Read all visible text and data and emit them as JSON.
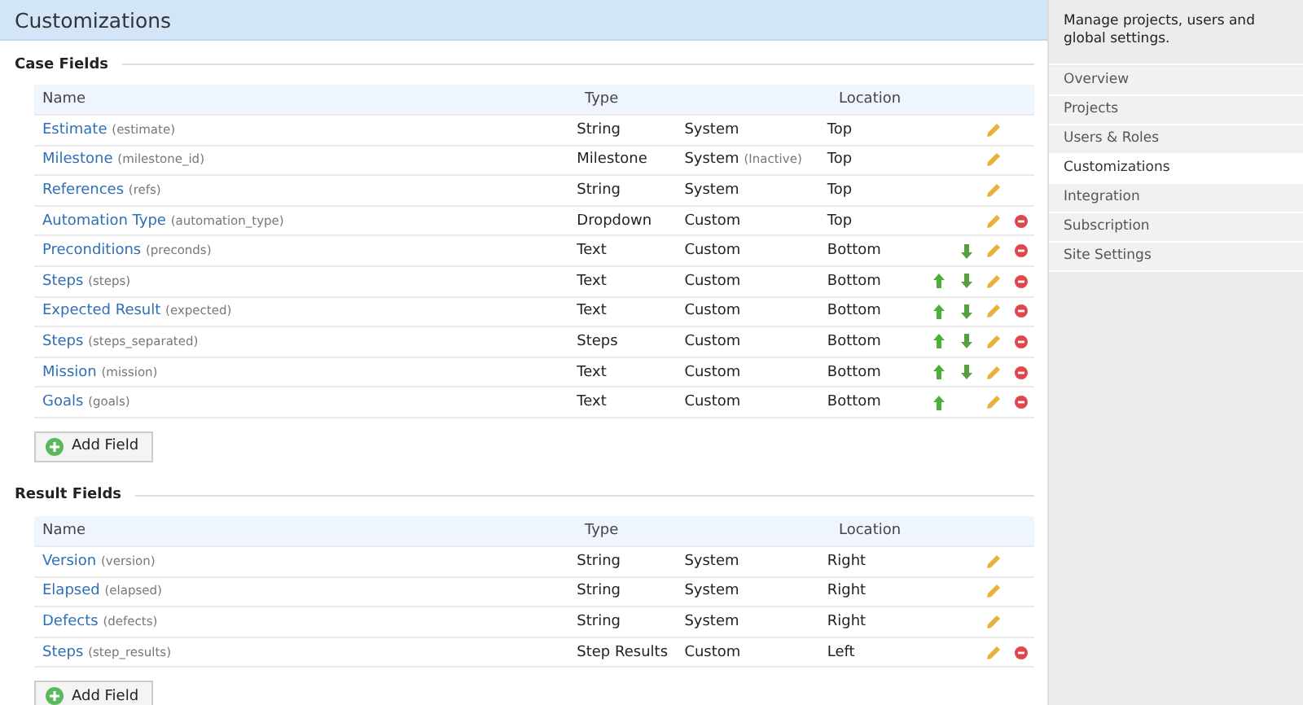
{
  "page_title": "Customizations",
  "sections": [
    {
      "title": "Case Fields",
      "columns": [
        "Name",
        "Type",
        "Location"
      ],
      "rows": [
        {
          "name": "Estimate",
          "key": "(estimate)",
          "type": "String",
          "source": "System",
          "location": "Top",
          "move_up": false,
          "move_down": false,
          "deletable": false
        },
        {
          "name": "Milestone",
          "key": "(milestone_id)",
          "type": "Milestone",
          "source": "System",
          "note": "(Inactive)",
          "location": "Top",
          "move_up": false,
          "move_down": false,
          "deletable": false
        },
        {
          "name": "References",
          "key": "(refs)",
          "type": "String",
          "source": "System",
          "location": "Top",
          "move_up": false,
          "move_down": false,
          "deletable": false
        },
        {
          "name": "Automation Type",
          "key": "(automation_type)",
          "type": "Dropdown",
          "source": "Custom",
          "location": "Top",
          "move_up": false,
          "move_down": false,
          "deletable": true
        },
        {
          "name": "Preconditions",
          "key": "(preconds)",
          "type": "Text",
          "source": "Custom",
          "location": "Bottom",
          "move_up": false,
          "move_down": true,
          "deletable": true
        },
        {
          "name": "Steps",
          "key": "(steps)",
          "type": "Text",
          "source": "Custom",
          "location": "Bottom",
          "move_up": true,
          "move_down": true,
          "deletable": true
        },
        {
          "name": "Expected Result",
          "key": "(expected)",
          "type": "Text",
          "source": "Custom",
          "location": "Bottom",
          "move_up": true,
          "move_down": true,
          "deletable": true
        },
        {
          "name": "Steps",
          "key": "(steps_separated)",
          "type": "Steps",
          "source": "Custom",
          "location": "Bottom",
          "move_up": true,
          "move_down": true,
          "deletable": true
        },
        {
          "name": "Mission",
          "key": "(mission)",
          "type": "Text",
          "source": "Custom",
          "location": "Bottom",
          "move_up": true,
          "move_down": true,
          "deletable": true
        },
        {
          "name": "Goals",
          "key": "(goals)",
          "type": "Text",
          "source": "Custom",
          "location": "Bottom",
          "move_up": true,
          "move_down": false,
          "deletable": true
        }
      ],
      "button": "Add Field"
    },
    {
      "title": "Result Fields",
      "columns": [
        "Name",
        "Type",
        "Location"
      ],
      "rows": [
        {
          "name": "Version",
          "key": "(version)",
          "type": "String",
          "source": "System",
          "location": "Right",
          "move_up": false,
          "move_down": false,
          "deletable": false
        },
        {
          "name": "Elapsed",
          "key": "(elapsed)",
          "type": "String",
          "source": "System",
          "location": "Right",
          "move_up": false,
          "move_down": false,
          "deletable": false
        },
        {
          "name": "Defects",
          "key": "(defects)",
          "type": "String",
          "source": "System",
          "location": "Right",
          "move_up": false,
          "move_down": false,
          "deletable": false
        },
        {
          "name": "Steps",
          "key": "(step_results)",
          "type": "Step Results",
          "source": "Custom",
          "location": "Left",
          "move_up": false,
          "move_down": false,
          "deletable": true
        }
      ],
      "button": "Add Field"
    }
  ],
  "sidebar": {
    "intro": "Manage projects, users and global settings.",
    "items": [
      {
        "label": "Overview",
        "selected": false
      },
      {
        "label": "Projects",
        "selected": false
      },
      {
        "label": "Users & Roles",
        "selected": false
      },
      {
        "label": "Customizations",
        "selected": true
      },
      {
        "label": "Integration",
        "selected": false
      },
      {
        "label": "Subscription",
        "selected": false
      },
      {
        "label": "Site Settings",
        "selected": false
      }
    ]
  }
}
